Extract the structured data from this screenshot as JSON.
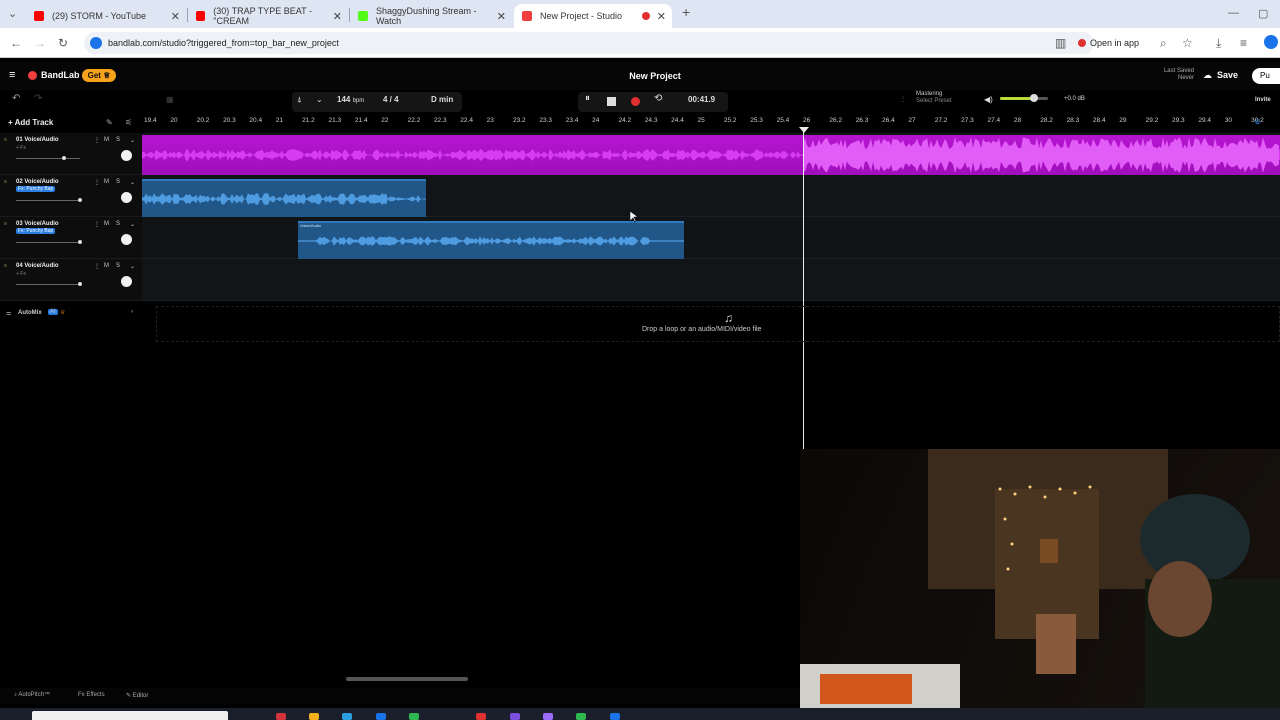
{
  "browser": {
    "tabs": [
      {
        "label": "(29) STORM - YouTube",
        "color": "#ff0000"
      },
      {
        "label": "(30) TRAP TYPE BEAT - \"CREAM",
        "color": "#ff0000"
      },
      {
        "label": "ShaggyDushing Stream - Watch",
        "color": "#53fc18"
      },
      {
        "label": "New Project - Studio",
        "color": "#f23e3e"
      }
    ],
    "url": "bandlab.com/studio?triggered_from=top_bar_new_project",
    "open_in_app": "Open in app"
  },
  "app": {
    "brand": "BandLab",
    "get_label": "Get",
    "project_title": "New Project",
    "last_saved": "Last Saved",
    "last_saved_value": "Never",
    "save_label": "Save",
    "publish_label": "Pu",
    "invite_label": "Invite"
  },
  "transport": {
    "bpm": "144",
    "bpm_unit": "bpm",
    "time_signature": "4 / 4",
    "key": "D min",
    "time": "00:41.9",
    "mastering": "Mastering",
    "mastering_preset": "Select Preset",
    "volume_db": "+0.0 dB",
    "volume_level": 0.7
  },
  "ruler": {
    "labels": [
      "19.4",
      "20",
      "20.2",
      "20.3",
      "20.4",
      "21",
      "21.2",
      "21.3",
      "21.4",
      "22",
      "22.2",
      "22.3",
      "22.4",
      "23",
      "23.2",
      "23.3",
      "23.4",
      "24",
      "24.2",
      "24.3",
      "24.4",
      "25",
      "25.2",
      "25.3",
      "25.4",
      "26",
      "26.2",
      "26.3",
      "26.4",
      "27",
      "27.2",
      "27.3",
      "27.4",
      "28",
      "28.2",
      "28.3",
      "28.4",
      "29",
      "29.2",
      "29.3",
      "29.4",
      "30",
      "30.2"
    ]
  },
  "add_track": "Add Track",
  "tracks": [
    {
      "name": "01 Voice/Audio",
      "fx": "+ Fx",
      "fx_badge": ""
    },
    {
      "name": "02 Voice/Audio",
      "fx": "",
      "fx_badge": "Fx: Punchy Bap"
    },
    {
      "name": "03 Voice/Audio",
      "fx": "",
      "fx_badge": "Fx: Punchy Bap"
    },
    {
      "name": "04 Voice/Audio",
      "fx": "+ Fx",
      "fx_badge": ""
    }
  ],
  "track_buttons": {
    "mute": "M",
    "solo": "S"
  },
  "clip_label": "Voice/Audio",
  "automix": "AutoMix",
  "automix_badge": "AI",
  "drop_text": "Drop a loop or an audio/MIDI/video file",
  "bottom_bar": {
    "autopitch": "AutoPitch™",
    "effects": "Effects",
    "editor": "Editor"
  },
  "colors": {
    "accent": "#f23e3e",
    "purple_clip": "#b614d0",
    "blue_clip": "#205688",
    "get_button": "#f7a21b"
  }
}
